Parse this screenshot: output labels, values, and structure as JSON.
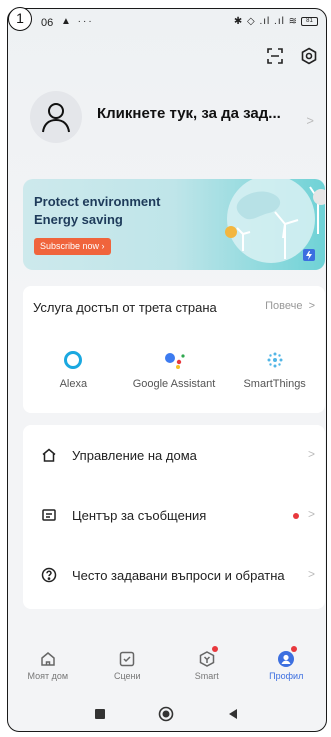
{
  "step_marker": "1",
  "status_bar": {
    "time": "06",
    "left_icons": "▲ ···",
    "right_icons": "✱ ◇ .ıl .ıl ≋",
    "battery": "81"
  },
  "header": {
    "scan_icon": "scan-icon",
    "settings_icon": "gear-icon"
  },
  "profile": {
    "title": "Кликнете тук, за да зад..."
  },
  "banner": {
    "line1": "Protect environment",
    "line2": "Energy saving",
    "cta": "Subscribe now ›"
  },
  "third_party": {
    "title": "Услуга достъп от трета страна",
    "more": "Повече",
    "services": [
      {
        "label": "Alexa"
      },
      {
        "label": "Google Assistant"
      },
      {
        "label": "SmartThings"
      }
    ]
  },
  "menu": [
    {
      "label": "Управление на дома",
      "icon": "home-icon"
    },
    {
      "label": "Център за съобщения",
      "icon": "message-icon"
    },
    {
      "label": "Често задавани въпроси и обратна",
      "icon": "help-icon"
    }
  ],
  "tabs": [
    {
      "label": "Моят дом",
      "icon": "home-icon"
    },
    {
      "label": "Сцени",
      "icon": "scenes-icon"
    },
    {
      "label": "Smart",
      "icon": "smart-icon"
    },
    {
      "label": "Профил",
      "icon": "profile-icon"
    }
  ],
  "colors": {
    "accent": "#3c6fe0",
    "badge": "#e8383d",
    "cta": "#f0643c"
  }
}
